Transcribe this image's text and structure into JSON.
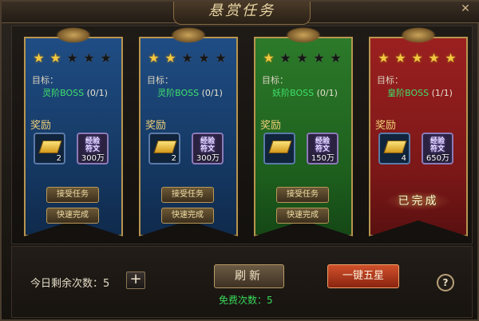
{
  "window": {
    "title": "悬赏任务",
    "close_icon": "✕"
  },
  "labels": {
    "target": "目标：",
    "reward": "奖励"
  },
  "cards": [
    {
      "color": "blue",
      "stars_on": 2,
      "stars_total": 5,
      "boss": "灵阶BOSS",
      "progress": "(0/1)",
      "gold_count": "2",
      "exp_text": "300万",
      "accept": "接受任务",
      "quick": "快速完成",
      "completed": false
    },
    {
      "color": "blue",
      "stars_on": 2,
      "stars_total": 5,
      "boss": "灵阶BOSS",
      "progress": "(0/1)",
      "gold_count": "2",
      "exp_text": "300万",
      "accept": "接受任务",
      "quick": "快速完成",
      "completed": false
    },
    {
      "color": "green",
      "stars_on": 1,
      "stars_total": 5,
      "boss": "妖阶BOSS",
      "progress": "(0/1)",
      "gold_count": "",
      "exp_text": "150万",
      "accept": "接受任务",
      "quick": "快速完成",
      "completed": false
    },
    {
      "color": "red",
      "stars_on": 5,
      "stars_total": 5,
      "boss": "皇阶BOSS",
      "progress": "(1/1)",
      "gold_count": "4",
      "exp_text": "650万",
      "completed": true,
      "done_text": "已完成"
    }
  ],
  "exp_glyph": "经验\n符文",
  "bottom": {
    "remain_label": "今日剩余次数：5",
    "plus": "+",
    "refresh": "刷新",
    "free": "免费次数：5",
    "five_star": "一键五星",
    "help": "?"
  },
  "colors": {
    "star_on": "#f2c640",
    "boss_text": "#3fe06a",
    "free_text": "#39d95a"
  }
}
